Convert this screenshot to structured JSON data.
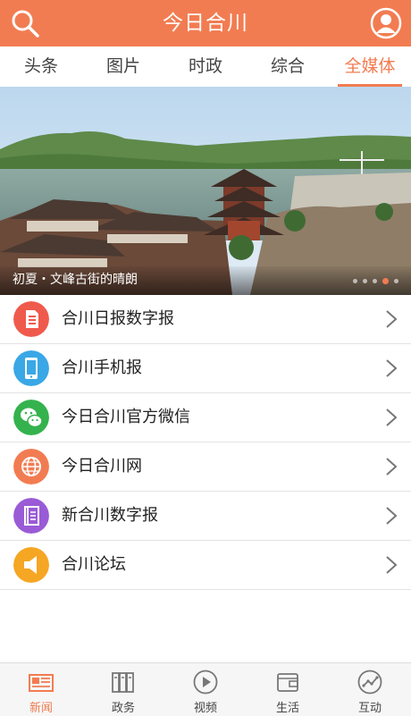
{
  "header": {
    "title": "今日合川",
    "search_icon": "search-icon",
    "user_icon": "user-icon"
  },
  "tabs": [
    {
      "label": "头条"
    },
    {
      "label": "图片"
    },
    {
      "label": "时政"
    },
    {
      "label": "综合"
    },
    {
      "label": "全媒体",
      "active": true
    }
  ],
  "banner": {
    "caption": "初夏・文峰古街的晴朗",
    "slides": 5,
    "current": 3
  },
  "list": [
    {
      "label": "合川日报数字报",
      "icon": "newspaper-icon",
      "color": "#ef5a4c"
    },
    {
      "label": "合川手机报",
      "icon": "phone-icon",
      "color": "#3aa7e6"
    },
    {
      "label": "今日合川官方微信",
      "icon": "wechat-icon",
      "color": "#34b24d"
    },
    {
      "label": "今日合川网",
      "icon": "globe-icon",
      "color": "#f27c52"
    },
    {
      "label": "新合川数字报",
      "icon": "book-icon",
      "color": "#9a5bd6"
    },
    {
      "label": "合川论坛",
      "icon": "megaphone-icon",
      "color": "#f5a623"
    }
  ],
  "bottom_nav": [
    {
      "label": "新闻",
      "icon": "news-icon",
      "active": true
    },
    {
      "label": "政务",
      "icon": "books-icon"
    },
    {
      "label": "视频",
      "icon": "play-icon"
    },
    {
      "label": "生活",
      "icon": "wallet-icon"
    },
    {
      "label": "互动",
      "icon": "trend-icon"
    }
  ],
  "colors": {
    "accent": "#f27c52"
  }
}
